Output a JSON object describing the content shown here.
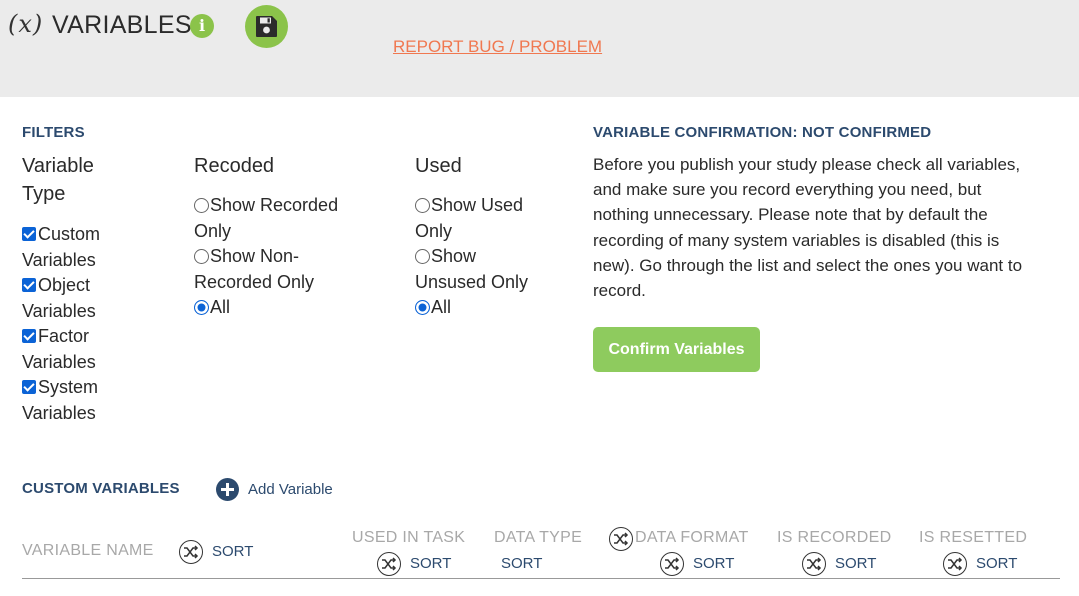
{
  "header": {
    "variable_icon": "(x)",
    "title": "VARIABLES",
    "info_icon": "info-icon",
    "save_icon": "floppy-disk-icon",
    "report_link": "REPORT BUG / PROBLEM"
  },
  "filters": {
    "heading": "FILTERS",
    "variable_type": {
      "title_line1": "Variable",
      "title_line2": "Type",
      "options": [
        {
          "line1": "Custom",
          "line2": "Variables",
          "checked": true
        },
        {
          "line1": "Object",
          "line2": "Variables",
          "checked": true
        },
        {
          "line1": "Factor",
          "line2": "Variables",
          "checked": true
        },
        {
          "line1": "System",
          "line2": "Variables",
          "checked": true
        }
      ]
    },
    "recoded": {
      "title": "Recoded",
      "options": [
        {
          "line1": "Show Recorded",
          "line2": "Only",
          "selected": false
        },
        {
          "line1": "Show Non-",
          "line2": "Recorded Only",
          "selected": false
        },
        {
          "line1": "All",
          "line2": "",
          "selected": true
        }
      ]
    },
    "used": {
      "title": "Used",
      "options": [
        {
          "line1": "Show Used",
          "line2": "Only",
          "selected": false
        },
        {
          "line1": "Show",
          "line2": "Unsused Only",
          "selected": false
        },
        {
          "line1": "All",
          "line2": "",
          "selected": true
        }
      ]
    }
  },
  "confirmation": {
    "heading": "VARIABLE CONFIRMATION: NOT CONFIRMED",
    "text": "Before you publish your study please check all variables, and make sure you record everything you need, but nothing unnecessary. Please note that by default the recording of many system variables is disabled (this is new). Go through the list and select the ones you want to record.",
    "button": "Confirm Variables"
  },
  "custom_variables": {
    "heading": "CUSTOM VARIABLES",
    "add_label": "Add Variable",
    "columns": [
      {
        "label": "VARIABLE NAME",
        "sort": "SORT"
      },
      {
        "label": "USED IN TASK",
        "sort": "SORT"
      },
      {
        "label": "DATA TYPE",
        "sort": "SORT"
      },
      {
        "label": "DATA FORMAT",
        "sort": "SORT"
      },
      {
        "label": "IS RECORDED",
        "sort": "SORT"
      },
      {
        "label": "IS RESETTED",
        "sort": "SORT"
      }
    ]
  },
  "colors": {
    "accent_green": "#8bc34a",
    "heading_navy": "#2c4a6e",
    "link_orange": "#f07850",
    "checkbox_blue": "#0b63d6"
  }
}
